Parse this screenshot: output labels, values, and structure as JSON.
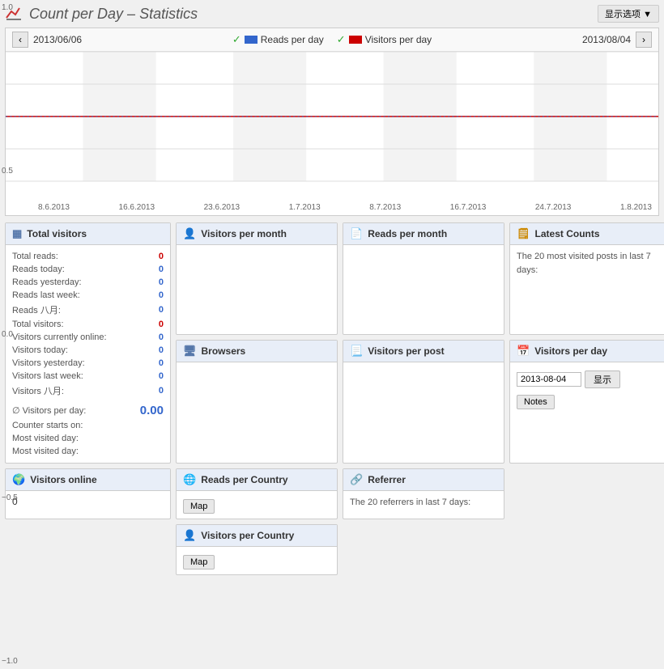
{
  "header": {
    "title": "Count per Day – Statistics",
    "display_options_label": "显示选项 ▼"
  },
  "chart": {
    "date_left": "2013/06/06",
    "date_right": "2013/08/04",
    "nav_left": "‹",
    "nav_right": "›",
    "legend": {
      "reads_check": "✓",
      "reads_label": "Reads per day",
      "visitors_check": "✓",
      "visitors_label": "Visitors per day"
    },
    "y_labels": [
      "1.0",
      "0.5",
      "0.0",
      "−0.5",
      "−1.0"
    ],
    "x_labels": [
      "8.6.2013",
      "16.6.2013",
      "23.6.2013",
      "1.7.2013",
      "8.7.2013",
      "16.7.2013",
      "24.7.2013",
      "1.8.2013"
    ]
  },
  "total_visitors": {
    "header": "Total visitors",
    "rows": [
      {
        "label": "Total reads:",
        "value": "0",
        "color": "red"
      },
      {
        "label": "Reads today:",
        "value": "0",
        "color": "blue"
      },
      {
        "label": "Reads yesterday:",
        "value": "0",
        "color": "blue"
      },
      {
        "label": "Reads last week:",
        "value": "0",
        "color": "blue"
      },
      {
        "label": "Reads 八月:",
        "value": "0",
        "color": "blue"
      },
      {
        "label": "Total visitors:",
        "value": "0",
        "color": "red"
      },
      {
        "label": "Visitors currently online:",
        "value": "0",
        "color": "blue"
      },
      {
        "label": "Visitors today:",
        "value": "0",
        "color": "blue"
      },
      {
        "label": "Visitors yesterday:",
        "value": "0",
        "color": "blue"
      },
      {
        "label": "Visitors last week:",
        "value": "0",
        "color": "blue"
      },
      {
        "label": "Visitors 八月:",
        "value": "0",
        "color": "blue"
      }
    ],
    "avg_label": "∅ Visitors per day:",
    "avg_value": "0.00",
    "counter_label": "Counter starts on:",
    "most_visited_1": "Most visited day:",
    "most_visited_2": "Most visited day:"
  },
  "visitors_online": {
    "header": "Visitors online",
    "value": "0"
  },
  "visitors_month": {
    "header": "Visitors per month"
  },
  "reads_month": {
    "header": "Reads per month"
  },
  "latest_counts": {
    "header": "Latest Counts",
    "description": "The 20 most visited posts in last 7 days:"
  },
  "browsers": {
    "header": "Browsers"
  },
  "visitors_post": {
    "header": "Visitors per post"
  },
  "visitors_day_right": {
    "header": "Visitors per day",
    "date_value": "2013-08-04",
    "display_label": "显示",
    "notes_label": "Notes"
  },
  "reads_country": {
    "header": "Reads per Country",
    "map_label": "Map"
  },
  "referrer": {
    "header": "Referrer",
    "description": "The 20 referrers in last 7 days:"
  },
  "visitors_country": {
    "header": "Visitors per Country",
    "map_label": "Map"
  }
}
